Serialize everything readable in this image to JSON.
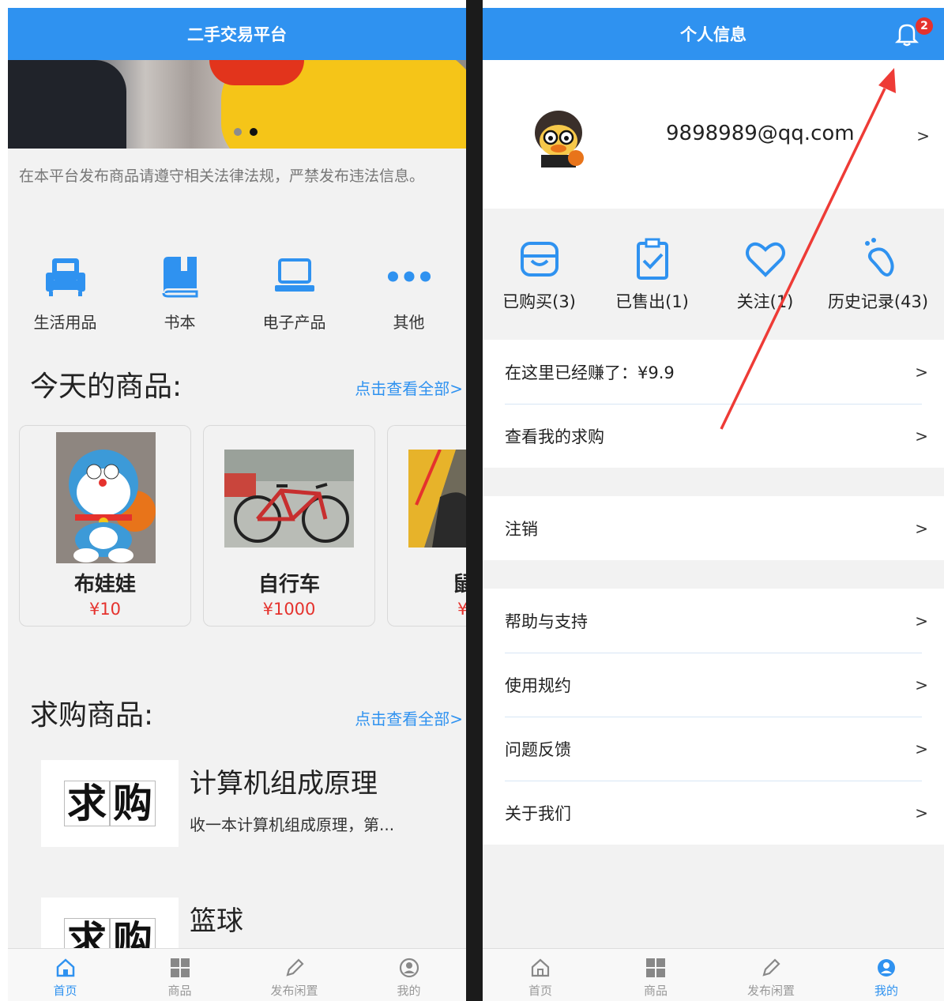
{
  "left": {
    "title": "二手交易平台",
    "notice": "在本平台发布商品请遵守相关法律法规，严禁发布违法信息。",
    "categories": [
      {
        "label": "生活用品",
        "icon": "sofa-icon"
      },
      {
        "label": "书本",
        "icon": "book-icon"
      },
      {
        "label": "电子产品",
        "icon": "laptop-icon"
      },
      {
        "label": "其他",
        "icon": "more-dots-icon"
      }
    ],
    "today_title": "今天的商品:",
    "view_all": "点击查看全部>",
    "goods": [
      {
        "name": "布娃娃",
        "price": "¥10"
      },
      {
        "name": "自行车",
        "price": "¥1000"
      },
      {
        "name": "鼠",
        "price": "¥"
      }
    ],
    "demand_title": "求购商品:",
    "demand_view_all": "点击查看全部>",
    "demand_badge": [
      "求",
      "购"
    ],
    "demands": [
      {
        "title": "计算机组成原理",
        "desc": "收一本计算机组成原理，第..."
      },
      {
        "title": "篮球",
        "desc": ""
      }
    ]
  },
  "tabs": [
    {
      "label": "首页",
      "icon": "home-icon"
    },
    {
      "label": "商品",
      "icon": "grid-icon"
    },
    {
      "label": "发布闲置",
      "icon": "pencil-icon"
    },
    {
      "label": "我的",
      "icon": "user-icon"
    }
  ],
  "right": {
    "title": "个人信息",
    "notification_count": "2",
    "email": "9898989@qq.com",
    "chevron": ">",
    "stats": [
      {
        "label": "已购买(3)",
        "icon": "shop-icon"
      },
      {
        "label": "已售出(1)",
        "icon": "clipboard-check-icon"
      },
      {
        "label": "关注(1)",
        "icon": "heart-icon"
      },
      {
        "label": "历史记录(43)",
        "icon": "footprint-icon"
      }
    ],
    "group1": [
      "在这里已经赚了：¥9.9",
      "查看我的求购"
    ],
    "group2": [
      "注销"
    ],
    "group3": [
      "帮助与支持",
      "使用规约",
      "问题反馈",
      "关于我们"
    ]
  },
  "colors": {
    "primary": "#2f92f0",
    "price": "#e5322d",
    "arrow": "#ee3b36"
  }
}
